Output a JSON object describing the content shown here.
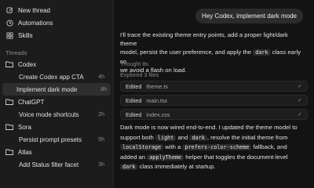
{
  "nav": [
    {
      "label": "New thread",
      "icon": "edit-icon"
    },
    {
      "label": "Automations",
      "icon": "clock-icon"
    },
    {
      "label": "Skills",
      "icon": "skills-icon"
    }
  ],
  "threads_label": "Threads",
  "folders": [
    {
      "name": "Codex",
      "threads": [
        {
          "title": "Create Codex app CTA",
          "time": "4h",
          "active": false
        },
        {
          "title": "Implement dark mode",
          "time": "8h",
          "active": true
        }
      ]
    },
    {
      "name": "ChatGPT",
      "threads": [
        {
          "title": "Voice mode shortcuts",
          "time": "2h",
          "active": false
        }
      ]
    },
    {
      "name": "Sora",
      "threads": [
        {
          "title": "Persist prompt presets",
          "time": "5h",
          "active": false
        }
      ]
    },
    {
      "name": "Atlas",
      "threads": [
        {
          "title": "Add Status filter facet",
          "time": "3h",
          "active": false
        }
      ]
    }
  ],
  "chat": {
    "user_message": "Hey Codex, implement dark mode",
    "intro_1": "I'll trace the existing theme entry points, add a proper light/dark theme",
    "intro_2": "model, persist the user preference, and apply the",
    "intro_code": "dark",
    "intro_3": "class early so",
    "intro_4": "we avoid a flash on load.",
    "thought": "Thought 8s",
    "explored": "Explored 3 files",
    "edits": [
      {
        "label": "Edited",
        "file": "theme.ts"
      },
      {
        "label": "Edited",
        "file": "main.tsx"
      },
      {
        "label": "Edited",
        "file": "index.css"
      }
    ],
    "summary": {
      "l1": "Dark mode is now wired end-to-end. I updated the theme model to",
      "l2a": "support both",
      "c_light": "light",
      "l2b": "and",
      "c_dark": "dark",
      "l2c": ", resolve the initial theme from",
      "c_ls": "localStorage",
      "l3a": "with a",
      "c_pcs": "prefers-color-scheme",
      "l3b": "fallback, and",
      "l4a": "added an",
      "c_apply": "applyTheme",
      "l4b": "helper that toggles the document-level",
      "c_dark2": "dark",
      "l5": "class immediately at startup."
    }
  }
}
